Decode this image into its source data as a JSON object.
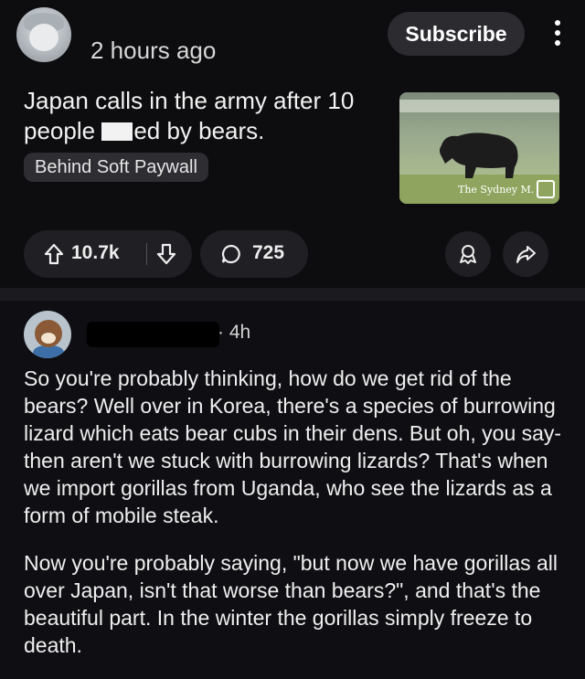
{
  "post": {
    "time_ago": "2 hours ago",
    "subscribe_label": "Subscribe",
    "title_part1": "Japan calls in the army after 10 people ",
    "title_part2": "ed by bears.",
    "flair": "Behind Soft Paywall",
    "thumbnail_watermark": "The Sydney M.",
    "upvotes": "10.7k",
    "comment_count": "725"
  },
  "comment": {
    "time": "· 4h",
    "paragraphs": [
      "So you're probably thinking, how do we get rid of the bears? Well over in Korea, there's a species of burrowing lizard which eats bear cubs in their dens. But oh, you say- then aren't we stuck with burrowing lizards? That's when we import gorillas from Uganda, who see the lizards as a form of mobile steak.",
      "Now you're probably saying, \"but now we have gorillas all over Japan, isn't that worse than bears?\", and that's the beautiful part. In the winter the gorillas simply freeze to death."
    ]
  },
  "icons": {
    "upvote": "arrow-up-icon",
    "downvote": "arrow-down-icon",
    "comment": "speech-bubble-icon",
    "award": "award-icon",
    "share": "share-arrow-icon",
    "more": "vertical-dots-icon"
  }
}
